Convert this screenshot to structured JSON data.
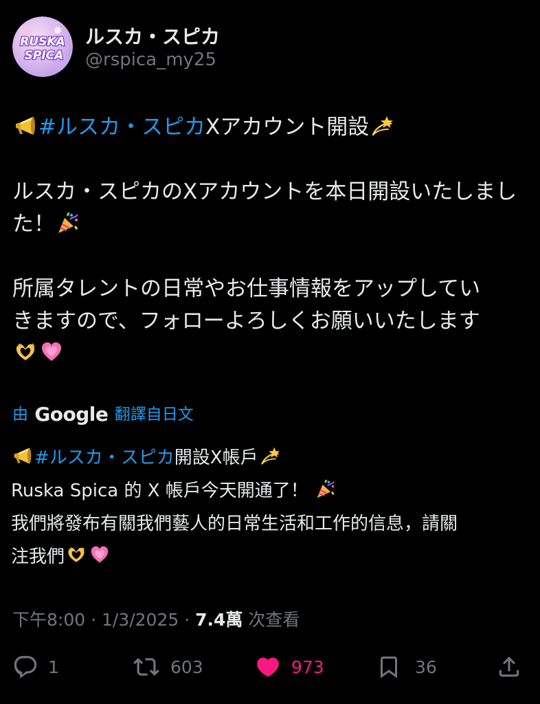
{
  "user": {
    "display_name": "ルスカ・スピカ",
    "handle": "@rspica_my25",
    "avatar_text_line1": "RUSKA",
    "avatar_text_line2": "SPICA"
  },
  "post": {
    "line1_hashtag": "#ルスカ・スピカ",
    "line1_text": "Xアカウント開設",
    "para2_text": "ルスカ・スピカのXアカウントを本日開設いたしました！",
    "para3_line1": "所属タレントの日常やお仕事情報をアップしてい",
    "para3_line2": "きますので、フォローよろしくお願いいたします"
  },
  "translation": {
    "prefix": "由",
    "brand": "Google",
    "suffix": "翻譯自日文",
    "line1_hashtag": "#ルスカ・スピカ",
    "line1_text": "開設X帳戶",
    "line2_text": "Ruska Spica 的 X 帳戶今天開通了！",
    "line3_text": "我們將發布有關我們藝人的日常生活和工作的信息，請關",
    "line4_text": "注我們"
  },
  "meta": {
    "time": "下午8:00",
    "sep1": " · ",
    "date": "1/3/2025",
    "sep2": " · ",
    "views_count": "7.4萬",
    "views_label": " 次查看"
  },
  "actions": {
    "replies": "1",
    "reposts": "603",
    "likes": "973",
    "bookmarks": "36"
  },
  "colors": {
    "background": "#000000",
    "text": "#e7e9ea",
    "secondary": "#71767b",
    "link": "#1d9bf0",
    "like": "#f91880"
  },
  "icons": {
    "megaphone": "megaphone-icon",
    "dizzy": "dizzy-icon",
    "party_popper": "party-popper-icon",
    "heart_hands": "heart-hands-icon",
    "growing_heart": "pink-heart-icon",
    "reply": "reply-icon",
    "repost": "repost-icon",
    "like": "heart-icon",
    "bookmark": "bookmark-icon",
    "share": "share-icon"
  }
}
